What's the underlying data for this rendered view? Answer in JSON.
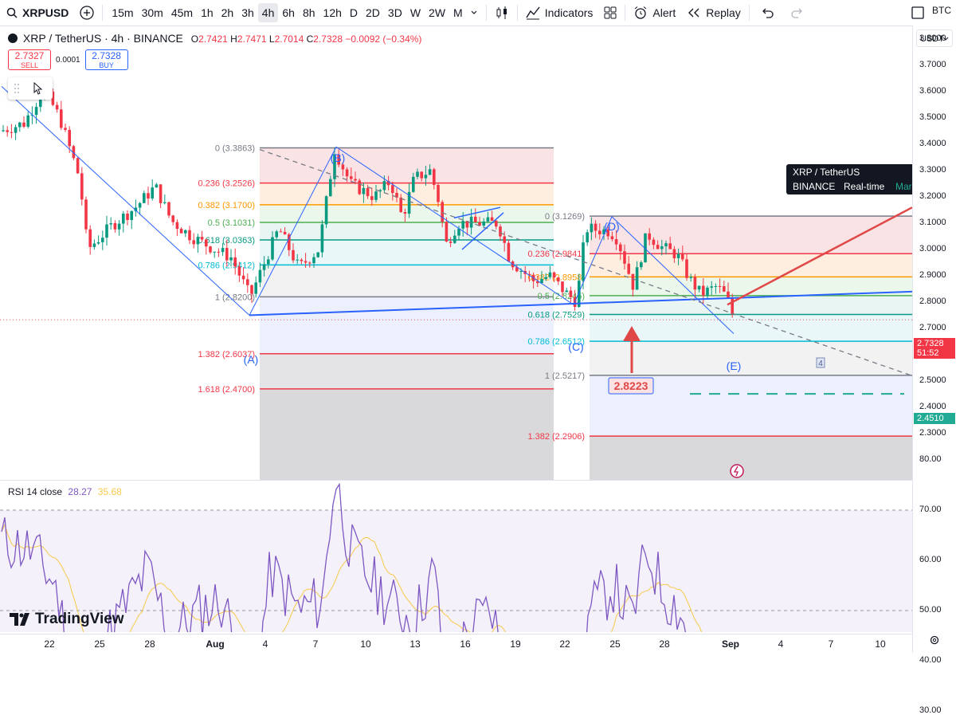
{
  "toolbar": {
    "symbol": "XRPUSD",
    "timeframes": [
      "15m",
      "30m",
      "45m",
      "1h",
      "2h",
      "3h",
      "4h",
      "6h",
      "8h",
      "12h",
      "D",
      "2D",
      "3D",
      "W",
      "2W",
      "M"
    ],
    "active_timeframe": "4h",
    "indicators_label": "Indicators",
    "alert_label": "Alert",
    "replay_label": "Replay",
    "right_symbol": "BTC"
  },
  "legend": {
    "title": "XRP / TetherUS · 4h · BINANCE",
    "o_label": "O",
    "o": "2.7421",
    "h_label": "H",
    "h": "2.7471",
    "l_label": "L",
    "l": "2.7014",
    "c_label": "C",
    "c": "2.7328",
    "change": "−0.0092 (−0.34%)"
  },
  "trade": {
    "sell_price": "2.7327",
    "sell_label": "SELL",
    "spread": "0.0001",
    "buy_price": "2.7328",
    "buy_label": "BUY"
  },
  "currency": "USDT",
  "price_axis": [
    "3.8000",
    "3.7000",
    "3.6000",
    "3.5000",
    "3.4000",
    "3.3000",
    "3.2000",
    "3.1000",
    "3.0000",
    "2.9000",
    "2.8000",
    "2.7000",
    "2.6000",
    "2.5000",
    "2.4000",
    "2.3000"
  ],
  "current_price": {
    "price": "2.7328",
    "countdown": "51:52",
    "color": "#f23645"
  },
  "target_price": {
    "price": "2.4510",
    "color": "#22ab94"
  },
  "tooltip": {
    "title": "XRP / TetherUS",
    "exchange": "BINANCE",
    "realtime": "Real-time",
    "status": "Market open"
  },
  "fib_left": [
    {
      "label": "0 (3.3863)",
      "price": 3.3863,
      "color": "#787b86"
    },
    {
      "label": "0.236 (3.2526)",
      "price": 3.2526,
      "color": "#f23645"
    },
    {
      "label": "0.382 (3.1700)",
      "price": 3.17,
      "color": "#ff9800"
    },
    {
      "label": "0.5 (3.1031)",
      "price": 3.1031,
      "color": "#4caf50"
    },
    {
      "label": "0.618 (3.0363)",
      "price": 3.0363,
      "color": "#089981"
    },
    {
      "label": "0.786 (2.9412)",
      "price": 2.9412,
      "color": "#00bcd4"
    },
    {
      "label": "1 (2.8200)",
      "price": 2.82,
      "color": "#787b86"
    },
    {
      "label": "1.382 (2.6037)",
      "price": 2.6037,
      "color": "#f23645"
    },
    {
      "label": "1.618 (2.4700)",
      "price": 2.47,
      "color": "#f23645"
    }
  ],
  "fib_right": [
    {
      "label": "0 (3.1269)",
      "price": 3.1269,
      "color": "#787b86"
    },
    {
      "label": "0.236 (2.9841)",
      "price": 2.9841,
      "color": "#f23645"
    },
    {
      "label": "0.382 (2.8958)",
      "price": 2.8958,
      "color": "#ff9800"
    },
    {
      "label": "0.5 (2.8245)",
      "price": 2.8245,
      "color": "#4caf50"
    },
    {
      "label": "0.618 (2.7529)",
      "price": 2.7529,
      "color": "#089981"
    },
    {
      "label": "0.786 (2.6512)",
      "price": 2.6512,
      "color": "#00bcd4"
    },
    {
      "label": "1 (2.5217)",
      "price": 2.5217,
      "color": "#787b86"
    },
    {
      "label": "1.382 (2.2906)",
      "price": 2.2906,
      "color": "#f23645"
    }
  ],
  "wave_labels": [
    "(A)",
    "(B)",
    "(C)",
    "(D)",
    "(E)"
  ],
  "callout": {
    "value": "2.8223"
  },
  "wave_marker": "4",
  "rsi": {
    "label": "RSI 14 close",
    "rsi_value": "28.27",
    "ma_value": "35.68",
    "axis": [
      "80.00",
      "70.00",
      "60.00",
      "50.00",
      "40.00",
      "30.00"
    ],
    "line_color": "#7e57c2",
    "ma_color": "#f7c948"
  },
  "time_axis": [
    "22",
    "25",
    "28",
    "Aug",
    "4",
    "7",
    "10",
    "13",
    "16",
    "19",
    "22",
    "25",
    "28",
    "Sep",
    "4",
    "7",
    "10"
  ],
  "brand": "TradingView"
}
